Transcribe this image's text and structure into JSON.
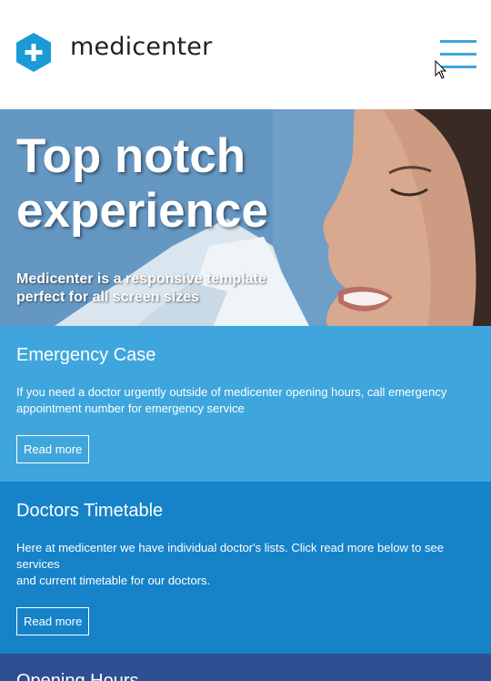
{
  "header": {
    "brand": "medicenter",
    "logo_icon": "medical-cross-hexagon-icon",
    "menu_icon": "hamburger-menu-icon"
  },
  "colors": {
    "accent": "#3ea6dc",
    "emergency_bg": "#3fa6dd",
    "timetable_bg": "#1682c8",
    "hours_bg": "#2e4f93"
  },
  "hero": {
    "title": "Top notch experience",
    "subtitle": "Medicenter is a responsive template perfect for all screen sizes"
  },
  "boxes": {
    "emergency": {
      "title": "Emergency Case",
      "text": "If you need a doctor urgently outside of medicenter opening hours, call emergency appointment number for emergency service",
      "button": "Read more"
    },
    "timetable": {
      "title": "Doctors Timetable",
      "text_line1": "Here at medicenter we have individual doctor's lists. Click read more below to see services",
      "text_line2": "and current timetable for our doctors.",
      "button": "Read more"
    },
    "hours": {
      "title": "Opening Hours"
    }
  }
}
